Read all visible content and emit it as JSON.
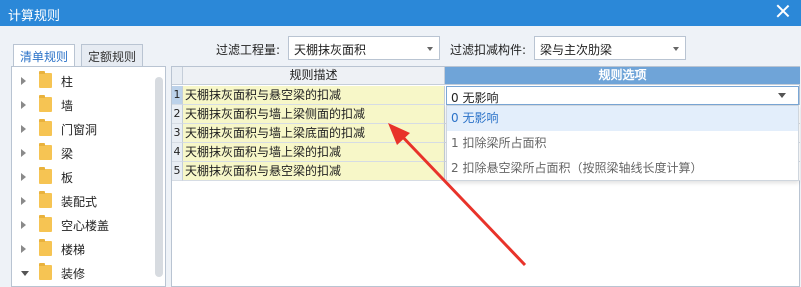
{
  "window": {
    "title": "计算规则"
  },
  "tabs": [
    {
      "label": "清单规则",
      "active": true
    },
    {
      "label": "定额规则",
      "active": false
    }
  ],
  "filters": {
    "quantity_label": "过滤工程量:",
    "quantity_value": "天棚抹灰面积",
    "deduct_label": "过滤扣减构件:",
    "deduct_value": "梁与主次肋梁"
  },
  "tree": {
    "items": [
      {
        "label": "柱",
        "expanded": false
      },
      {
        "label": "墙",
        "expanded": false
      },
      {
        "label": "门窗洞",
        "expanded": false
      },
      {
        "label": "梁",
        "expanded": false
      },
      {
        "label": "板",
        "expanded": false
      },
      {
        "label": "装配式",
        "expanded": false
      },
      {
        "label": "空心楼盖",
        "expanded": false
      },
      {
        "label": "楼梯",
        "expanded": false
      },
      {
        "label": "装修",
        "expanded": true
      }
    ]
  },
  "grid": {
    "columns": {
      "description": "规则描述",
      "option": "规则选项"
    },
    "rows": [
      {
        "num": "1",
        "description": "天棚抹灰面积与悬空梁的扣减",
        "option": "0  无影响"
      },
      {
        "num": "2",
        "description": "天棚抹灰面积与墙上梁侧面的扣减",
        "option": ""
      },
      {
        "num": "3",
        "description": "天棚抹灰面积与墙上梁底面的扣减",
        "option": ""
      },
      {
        "num": "4",
        "description": "天棚抹灰面积与墙上梁的扣减",
        "option": ""
      },
      {
        "num": "5",
        "description": "天棚抹灰面积与悬空梁的扣减",
        "option": ""
      }
    ],
    "selected_row": 1
  },
  "dropdown": {
    "options": [
      {
        "label": "0  无影响",
        "active": true
      },
      {
        "label": "1 扣除梁所占面积",
        "active": false
      },
      {
        "label": "2 扣除悬空梁所占面积（按照梁轴线长度计算）",
        "active": false
      }
    ]
  },
  "colors": {
    "titlebar": "#2b88d8",
    "option_header": "#6fa4d8",
    "description_cell": "#f7f7c8",
    "annotation_arrow": "#e8332a"
  },
  "icons": {
    "close": "close-icon",
    "folder": "folder-icon",
    "caret": "chevron-down-icon"
  }
}
